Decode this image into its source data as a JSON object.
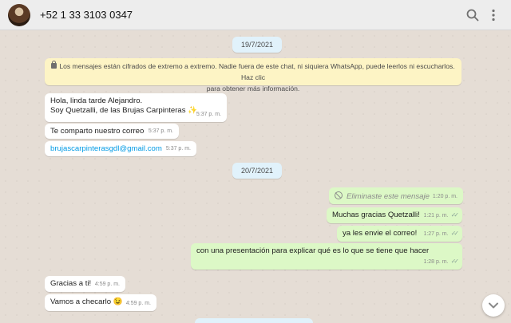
{
  "header": {
    "contact_name": "+52 1 33 3103 0347",
    "icons": [
      "avatar",
      "search-icon",
      "menu-icon"
    ]
  },
  "dates": {
    "first": "19/7/2021",
    "second": "20/7/2021"
  },
  "notice": {
    "line1": "Los mensajes están cifrados de extremo a extremo. Nadie fuera de este chat, ni siquiera WhatsApp, puede leerlos ni escucharlos. Haz clic",
    "line2": "para obtener más información."
  },
  "messages": [
    {
      "direction": "in",
      "lines": [
        "Hola, linda tarde Alejandro.",
        "Soy Quetzalli, de las Brujas Carpinteras ✨"
      ],
      "time": "5:37 p. m."
    },
    {
      "direction": "in",
      "text": "Te comparto nuestro correo",
      "time": "5:37 p. m."
    },
    {
      "direction": "in",
      "text": "brujascarpinterasgdl@gmail.com",
      "time": "5:37 p. m."
    },
    {
      "direction": "out",
      "text": "Eliminaste este mensaje",
      "time": "1:20 p. m.",
      "deleted": true
    },
    {
      "direction": "out",
      "text": "Muchas gracias Quetzalli!",
      "time": "1:21 p. m."
    },
    {
      "direction": "out",
      "text": "ya les envie el correo!",
      "time": "1:27 p. m."
    },
    {
      "direction": "out",
      "text": "con una presentación para explicar qué es lo que se tiene que hacer",
      "time": "1:28 p. m."
    },
    {
      "direction": "in",
      "text": "Gracias a ti!",
      "time": "4:59 p. m."
    },
    {
      "direction": "in",
      "text": "Vamos a checarlo 😉",
      "time": "4:59 p. m."
    }
  ],
  "colors": {
    "incoming": "#ffffff",
    "outgoing": "#dcf8c6",
    "notice": "#fdf4c5",
    "date_pill": "#e1f2fb",
    "link": "#039be5"
  }
}
